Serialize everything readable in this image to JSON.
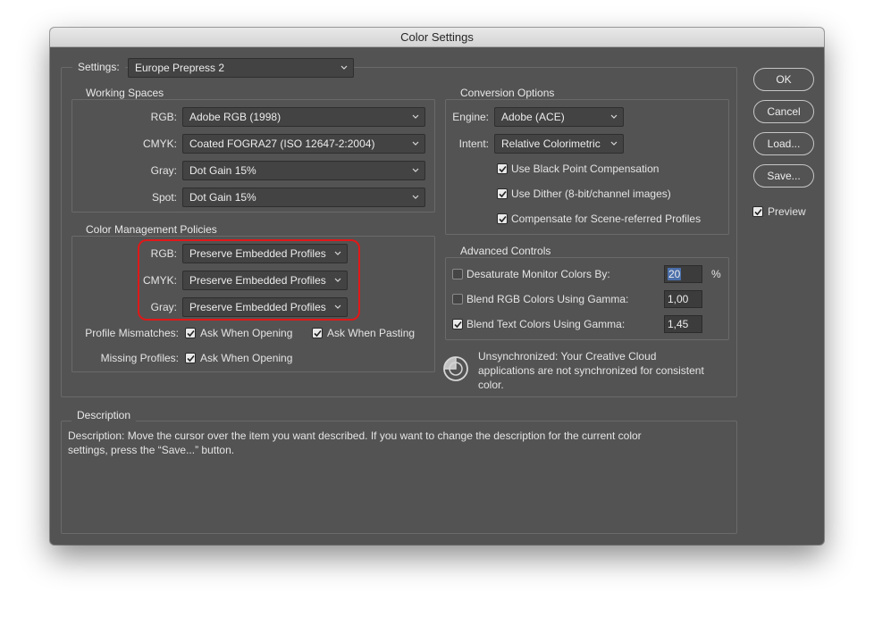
{
  "window": {
    "title": "Color Settings"
  },
  "settings": {
    "label": "Settings:",
    "value": "Europe Prepress 2"
  },
  "working_spaces": {
    "title": "Working Spaces",
    "rgb": {
      "label": "RGB:",
      "value": "Adobe RGB (1998)"
    },
    "cmyk": {
      "label": "CMYK:",
      "value": "Coated FOGRA27 (ISO 12647-2:2004)"
    },
    "gray": {
      "label": "Gray:",
      "value": "Dot Gain 15%"
    },
    "spot": {
      "label": "Spot:",
      "value": "Dot Gain 15%"
    }
  },
  "policies": {
    "title": "Color Management Policies",
    "rgb": {
      "label": "RGB:",
      "value": "Preserve Embedded Profiles"
    },
    "cmyk": {
      "label": "CMYK:",
      "value": "Preserve Embedded Profiles"
    },
    "gray": {
      "label": "Gray:",
      "value": "Preserve Embedded Profiles"
    },
    "profile_mismatches": {
      "label": "Profile Mismatches:",
      "ask_opening": "Ask When Opening",
      "ask_pasting": "Ask When Pasting",
      "ask_opening_checked": true,
      "ask_pasting_checked": true
    },
    "missing_profiles": {
      "label": "Missing Profiles:",
      "ask_opening": "Ask When Opening",
      "ask_opening_checked": true
    },
    "highlight_color": "#e01818"
  },
  "conversion": {
    "title": "Conversion Options",
    "engine": {
      "label": "Engine:",
      "value": "Adobe (ACE)"
    },
    "intent": {
      "label": "Intent:",
      "value": "Relative Colorimetric"
    },
    "black_point": {
      "label": "Use Black Point Compensation",
      "checked": true
    },
    "dither": {
      "label": "Use Dither (8-bit/channel images)",
      "checked": true
    },
    "scene_referred": {
      "label": "Compensate for Scene-referred Profiles",
      "checked": true
    }
  },
  "advanced": {
    "title": "Advanced Controls",
    "desaturate": {
      "label": "Desaturate Monitor Colors By:",
      "value": "20",
      "unit": "%",
      "checked": false
    },
    "blend_rgb": {
      "label": "Blend RGB Colors Using Gamma:",
      "value": "1,00",
      "checked": false
    },
    "blend_text": {
      "label": "Blend Text Colors Using Gamma:",
      "value": "1,45",
      "checked": true
    }
  },
  "sync_status": {
    "icon": "sync-status-icon",
    "text_line1": "Unsynchronized: Your Creative Cloud",
    "text_line2": "applications are not synchronized for consistent",
    "text_line3": "color."
  },
  "description": {
    "title": "Description",
    "line1": "Description:  Move the cursor over the item you want described.  If you want to change the description for the current color",
    "line2": "settings, press the “Save...” button."
  },
  "buttons": {
    "ok": "OK",
    "cancel": "Cancel",
    "load": "Load...",
    "save": "Save..."
  },
  "preview": {
    "label": "Preview",
    "checked": true
  },
  "colors": {
    "window_bg": "#535353",
    "accent_selection": "#4b6fab"
  }
}
